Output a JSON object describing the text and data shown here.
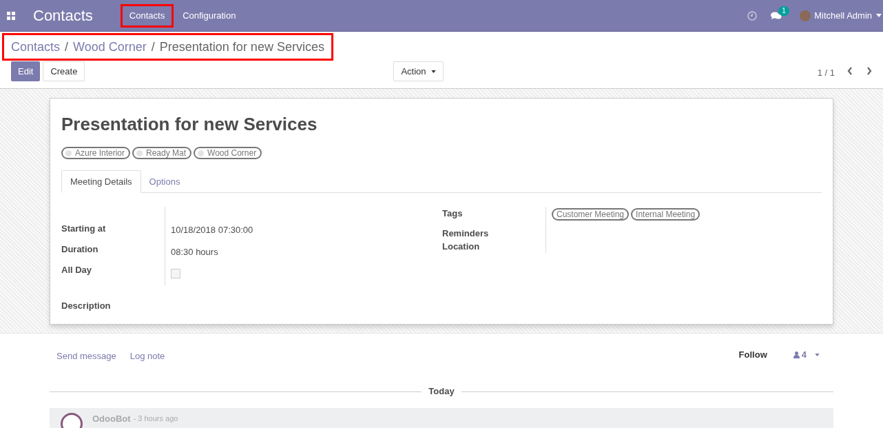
{
  "navbar": {
    "app_title": "Contacts",
    "menus": [
      {
        "label": "Contacts",
        "highlighted": true
      },
      {
        "label": "Configuration",
        "highlighted": false
      }
    ],
    "message_count": "1",
    "user": "Mitchell Admin"
  },
  "breadcrumb": {
    "highlighted": true,
    "separator": "/",
    "items": [
      {
        "label": "Contacts",
        "link": true
      },
      {
        "label": "Wood Corner",
        "link": true
      },
      {
        "label": "Presentation for new Services",
        "link": false
      }
    ]
  },
  "toolbar": {
    "buttons": [
      {
        "label": "Edit",
        "primary": true
      },
      {
        "label": "Create",
        "primary": false
      }
    ],
    "action": "Action",
    "pager": "1 / 1"
  },
  "record": {
    "title": "Presentation for new Services",
    "attendees": [
      "Azure Interior",
      "Ready Mat",
      "Wood Corner"
    ],
    "tabs": [
      {
        "label": "Meeting Details",
        "selected": true
      },
      {
        "label": "Options",
        "selected": false
      }
    ],
    "left_fields": [
      {
        "label": "Starting at",
        "kind": "text",
        "value": "10/18/2018 07:30:00"
      },
      {
        "label": "Duration",
        "kind": "text",
        "value": "08:30 hours"
      },
      {
        "label": "All Day",
        "kind": "checkbox",
        "checked": false
      }
    ],
    "right_fields": [
      {
        "label": "Tags",
        "tags": [
          "Customer Meeting",
          "Internal Meeting"
        ]
      },
      {
        "label": "Reminders"
      },
      {
        "label": "Location"
      }
    ],
    "description_label": "Description"
  },
  "chatter": {
    "send_message": "Send message",
    "log_note": "Log note",
    "follow": "Follow",
    "followers": "4",
    "date_separator": "Today",
    "messages": [
      {
        "author": "OdooBot",
        "time": "- 3 hours ago"
      }
    ]
  }
}
